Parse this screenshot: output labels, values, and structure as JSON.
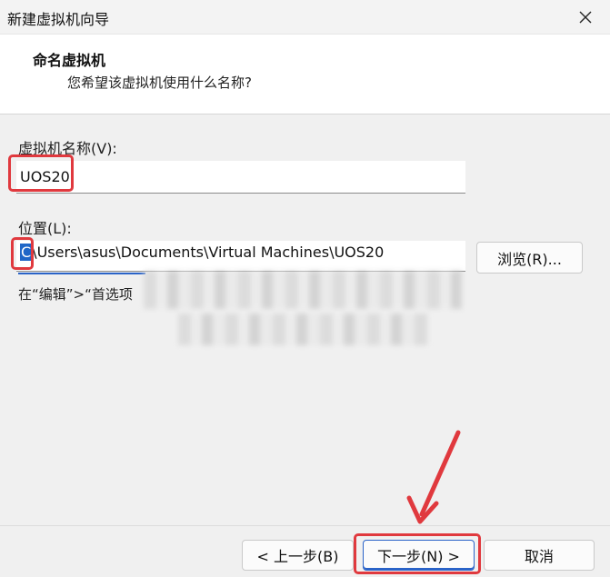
{
  "window": {
    "title": "新建虚拟机向导",
    "close_glyph": "✕"
  },
  "header": {
    "title": "命名虚拟机",
    "subtitle": "您希望该虚拟机使用什么名称?"
  },
  "form": {
    "name_label": "虚拟机名称(V):",
    "name_value": "UOS20",
    "location_label": "位置(L):",
    "location_first_char": "C",
    "location_rest": "\\Users\\asus\\Documents\\Virtual Machines\\UOS20",
    "browse_label": "浏览(R)...",
    "hint_prefix": "在“编辑”>“首选项"
  },
  "buttons": {
    "back": "< 上一步(B)",
    "next": "下一步(N) >",
    "cancel": "取消"
  },
  "colors": {
    "highlight": "#e0393e",
    "selection": "#1f66c7",
    "arrow": "#e0393e"
  },
  "icons": {
    "close": "close-icon"
  }
}
